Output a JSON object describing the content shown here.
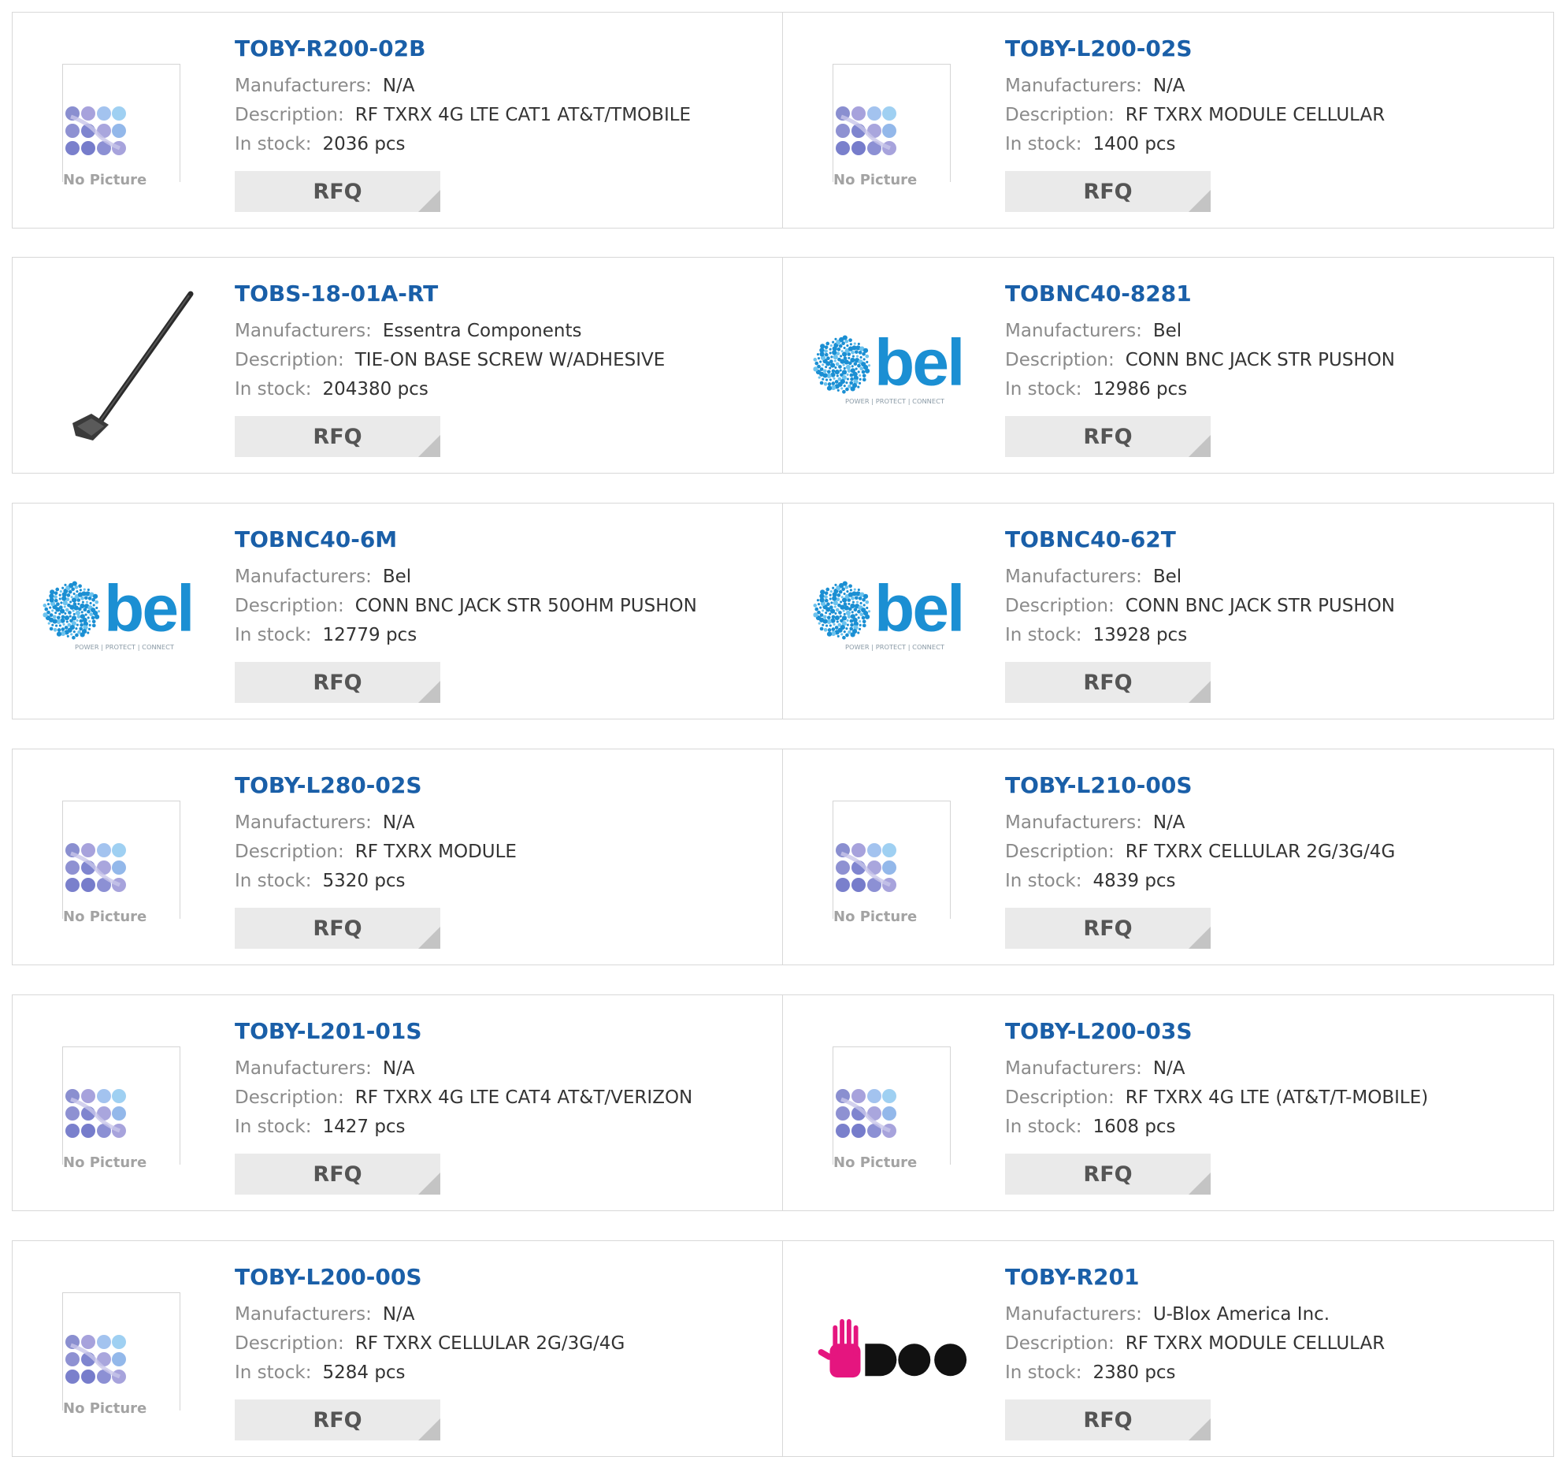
{
  "labels": {
    "manufacturers": "Manufacturers:",
    "description": "Description:",
    "in_stock": "In stock:",
    "rfq": "RFQ",
    "no_picture": "No Picture",
    "bel_wordmark": "bel",
    "bel_tagline": "POWER | PROTECT | CONNECT"
  },
  "colors": {
    "part_number": "#1a5fa8",
    "label": "#8a8a8a",
    "value": "#333333",
    "rfq_bg": "#eaeaea",
    "bel_blue": "#1b8fd3",
    "ublox_pink": "#e5157f"
  },
  "products": [
    {
      "part": "TOBY-R200-02B",
      "manufacturer": "N/A",
      "description": "RF TXRX 4G LTE CAT1 AT&T/TMOBILE",
      "stock": "2036 pcs",
      "image": "no-picture"
    },
    {
      "part": "TOBY-L200-02S",
      "manufacturer": "N/A",
      "description": "RF TXRX MODULE CELLULAR",
      "stock": "1400 pcs",
      "image": "no-picture"
    },
    {
      "part": "TOBS-18-01A-RT",
      "manufacturer": "Essentra Components",
      "description": "TIE-ON BASE SCREW W/ADHESIVE",
      "stock": "204380 pcs",
      "image": "cable-tie"
    },
    {
      "part": "TOBNC40-8281",
      "manufacturer": "Bel",
      "description": "CONN BNC JACK STR PUSHON",
      "stock": "12986 pcs",
      "image": "bel-logo"
    },
    {
      "part": "TOBNC40-6M",
      "manufacturer": "Bel",
      "description": "CONN BNC JACK STR 50OHM PUSHON",
      "stock": "12779 pcs",
      "image": "bel-logo"
    },
    {
      "part": "TOBNC40-62T",
      "manufacturer": "Bel",
      "description": "CONN BNC JACK STR PUSHON",
      "stock": "13928 pcs",
      "image": "bel-logo"
    },
    {
      "part": "TOBY-L280-02S",
      "manufacturer": "N/A",
      "description": "RF TXRX MODULE",
      "stock": "5320 pcs",
      "image": "no-picture"
    },
    {
      "part": "TOBY-L210-00S",
      "manufacturer": "N/A",
      "description": "RF TXRX CELLULAR 2G/3G/4G",
      "stock": "4839 pcs",
      "image": "no-picture"
    },
    {
      "part": "TOBY-L201-01S",
      "manufacturer": "N/A",
      "description": "RF TXRX 4G LTE CAT4 AT&T/VERIZON",
      "stock": "1427 pcs",
      "image": "no-picture"
    },
    {
      "part": "TOBY-L200-03S",
      "manufacturer": "N/A",
      "description": "RF TXRX 4G LTE (AT&T/T-MOBILE)",
      "stock": "1608 pcs",
      "image": "no-picture"
    },
    {
      "part": "TOBY-L200-00S",
      "manufacturer": "N/A",
      "description": "RF TXRX CELLULAR 2G/3G/4G",
      "stock": "5284 pcs",
      "image": "no-picture"
    },
    {
      "part": "TOBY-R201",
      "manufacturer": "U-Blox America Inc.",
      "description": "RF TXRX MODULE CELLULAR",
      "stock": "2380 pcs",
      "image": "ublox-logo"
    }
  ]
}
